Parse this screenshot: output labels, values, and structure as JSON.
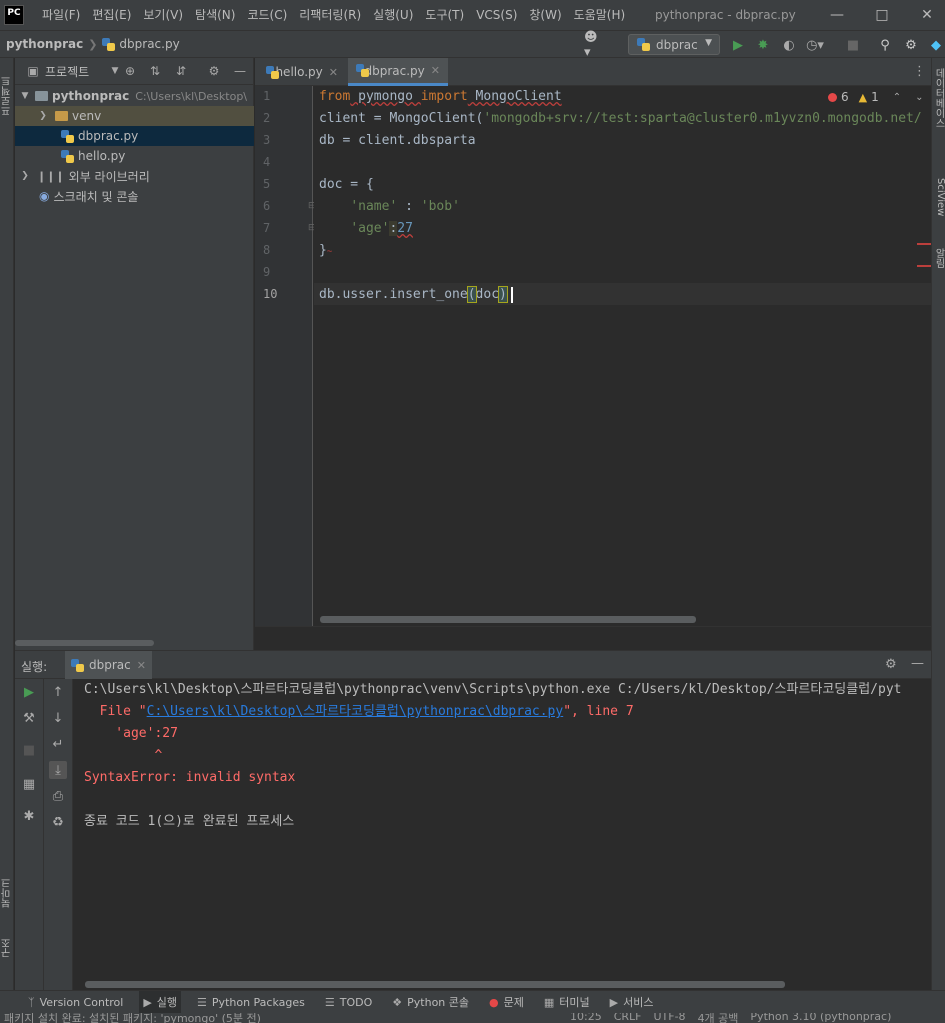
{
  "app": {
    "logo": "PC",
    "window_title": "pythonprac - dbprac.py"
  },
  "menu": [
    "파일(F)",
    "편집(E)",
    "보기(V)",
    "탐색(N)",
    "코드(C)",
    "리팩터링(R)",
    "실행(U)",
    "도구(T)",
    "VCS(S)",
    "창(W)",
    "도움말(H)"
  ],
  "nav": {
    "project": "pythonprac",
    "file": "dbprac.py",
    "run_config": "dbprac"
  },
  "left_strip": {
    "project_tab": "프로젝트",
    "bookmarks_tab": "북마크",
    "structure_tab": "구조"
  },
  "right_strip": {
    "database_tab": "데이터베이스",
    "sciview_tab": "SciView",
    "notifications_tab": "알림"
  },
  "project_panel": {
    "title": "프로젝트",
    "tree": [
      {
        "label": "pythonprac",
        "hint": "C:\\Users\\kl\\Desktop\\",
        "type": "root"
      },
      {
        "label": "venv",
        "type": "venv"
      },
      {
        "label": "dbprac.py",
        "type": "file"
      },
      {
        "label": "hello.py",
        "type": "file"
      },
      {
        "label": "외부 라이브러리",
        "type": "lib"
      },
      {
        "label": "스크래치 및 콘솔",
        "type": "scratch"
      }
    ]
  },
  "editor": {
    "tabs": [
      {
        "label": "hello.py"
      },
      {
        "label": "dbprac.py"
      }
    ],
    "line_numbers": [
      "1",
      "2",
      "3",
      "4",
      "5",
      "6",
      "7",
      "8",
      "9",
      "10"
    ],
    "code": {
      "l1_kw1": "from",
      "l1_mod": " pymongo ",
      "l1_kw2": "import",
      "l1_cls": " MongoClient",
      "l2_pre": "client = MongoClient(",
      "l2_str": "'mongodb+srv://test:sparta@cluster0.m1yvzn0.mongodb.net/",
      "l3": "db = client.dbsparta",
      "l5": "doc = {",
      "l6_key": "'name'",
      "l6_mid": " : ",
      "l6_val": "'bob'",
      "l7_key": "'age'",
      "l7_colon": ":",
      "l7_val": "27",
      "l8": "}",
      "l10_pre": "db.usser.insert_one",
      "l10_open": "(",
      "l10_arg": "doc",
      "l10_close": ")"
    },
    "inspections": {
      "errors": "6",
      "warnings": "1"
    }
  },
  "run_panel": {
    "header": "실행:",
    "tab": "dbprac",
    "console": {
      "l1": "C:\\Users\\kl\\Desktop\\스파르타코딩클럽\\pythonprac\\venv\\Scripts\\python.exe C:/Users/kl/Desktop/스파르타코딩클럽/pyt",
      "l2_pre": "  File \"",
      "l2_link": "C:\\Users\\kl\\Desktop\\스파르타코딩클럽\\pythonprac\\dbprac.py",
      "l2_post": "\", line 7",
      "l3": "    'age':27",
      "l4": "         ^",
      "l5": "SyntaxError: invalid syntax",
      "l7": "종료 코드 1(으)로 완료된 프로세스"
    }
  },
  "bottom_tools": [
    "Version Control",
    "실행",
    "Python Packages",
    "TODO",
    "Python 콘솔",
    "문제",
    "터미널",
    "서비스"
  ],
  "status": {
    "message": "패키지 설치 완료: 설치된 패키지: 'pymongo' (5분 전)",
    "position": "10:25",
    "line_sep": "CRLF",
    "encoding": "UTF-8",
    "indent": "4개 공백",
    "interpreter": "Python 3.10 (pythonprac)"
  },
  "colors": {
    "background": "#2b2b2b",
    "panel": "#3c3f41",
    "keyword": "#cc7832",
    "string": "#6a8759",
    "number": "#6897bb",
    "error": "#ff6b68",
    "link": "#287bde",
    "run_green": "#499c54"
  }
}
